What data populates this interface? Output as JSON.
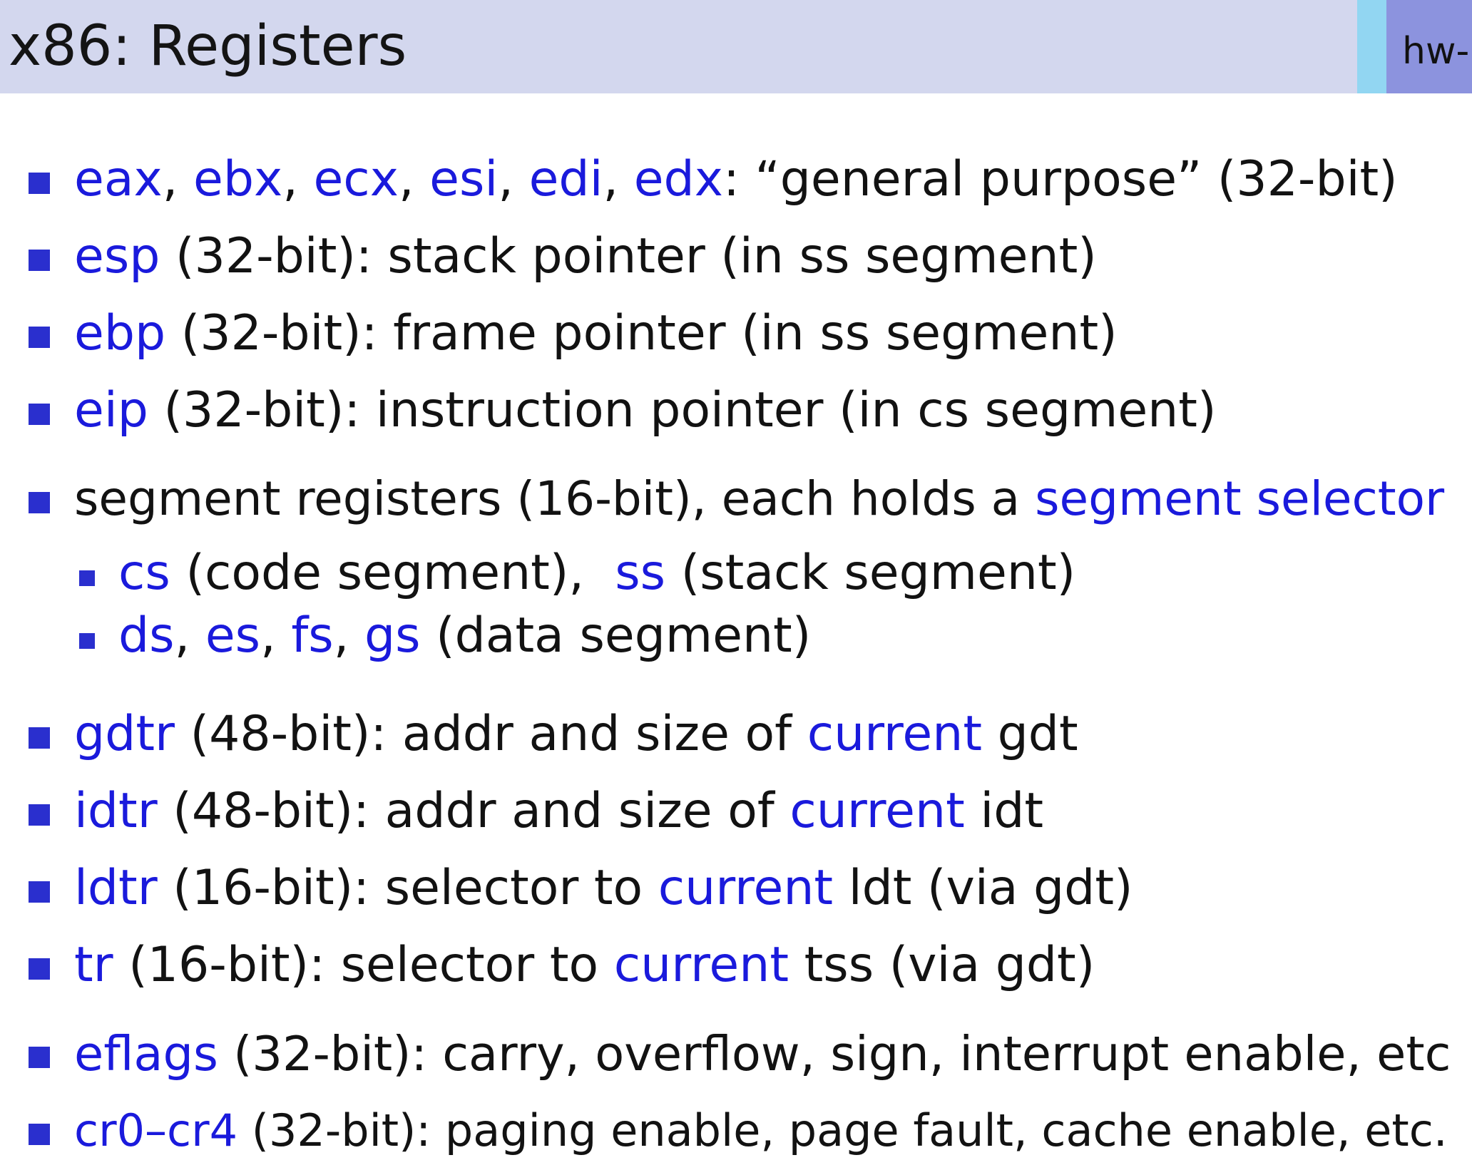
{
  "slide": {
    "title": "x86: Registers",
    "corner_tag": "hw-"
  },
  "colors": {
    "header_bg": "#d3d7ee",
    "tag_strip": "#92d6f2",
    "tag_box": "#8c93de",
    "accent_blue": "#1a1adc",
    "bullet_blue": "#2a2fce",
    "text": "#121212"
  },
  "items": [
    {
      "keywords": [
        "eax",
        "ebx",
        "ecx",
        "esi",
        "edi",
        "edx"
      ],
      "sep": ", ",
      "rest": ": “general purpose” (32-bit)"
    },
    {
      "kw": "esp",
      "rest": " (32-bit): stack pointer (in ss segment)"
    },
    {
      "kw": "ebp",
      "rest": " (32-bit): frame pointer (in ss segment)"
    },
    {
      "kw": "eip",
      "rest": " (32-bit): instruction pointer (in cs segment)"
    },
    {
      "pre": "segment registers (16-bit), each holds a ",
      "kw": "segment selector",
      "sub": [
        {
          "kw1": "cs",
          "mid": " (code segment),  ",
          "kw2": "ss",
          "rest": " (stack segment)"
        },
        {
          "kws": [
            "ds",
            "es",
            "fs",
            "gs"
          ],
          "rest": " (data segment)"
        }
      ]
    },
    {
      "kw": "gdtr",
      "mid": " (48-bit): addr and size of ",
      "kw2": "current",
      "rest": " gdt"
    },
    {
      "kw": "idtr",
      "mid": " (48-bit): addr and size of ",
      "kw2": "current",
      "rest": " idt"
    },
    {
      "kw": "ldtr",
      "mid": " (16-bit): selector to ",
      "kw2": "current",
      "rest": " ldt (via gdt)"
    },
    {
      "kw": "tr",
      "mid": " (16-bit): selector to ",
      "kw2": "current",
      "rest": " tss (via gdt)"
    },
    {
      "kw": "eflags",
      "rest": " (32-bit): carry, overflow, sign, interrupt enable, etc"
    },
    {
      "kw": "cr0–cr4",
      "rest": " (32-bit): paging enable, page fault, cache enable, etc."
    }
  ]
}
